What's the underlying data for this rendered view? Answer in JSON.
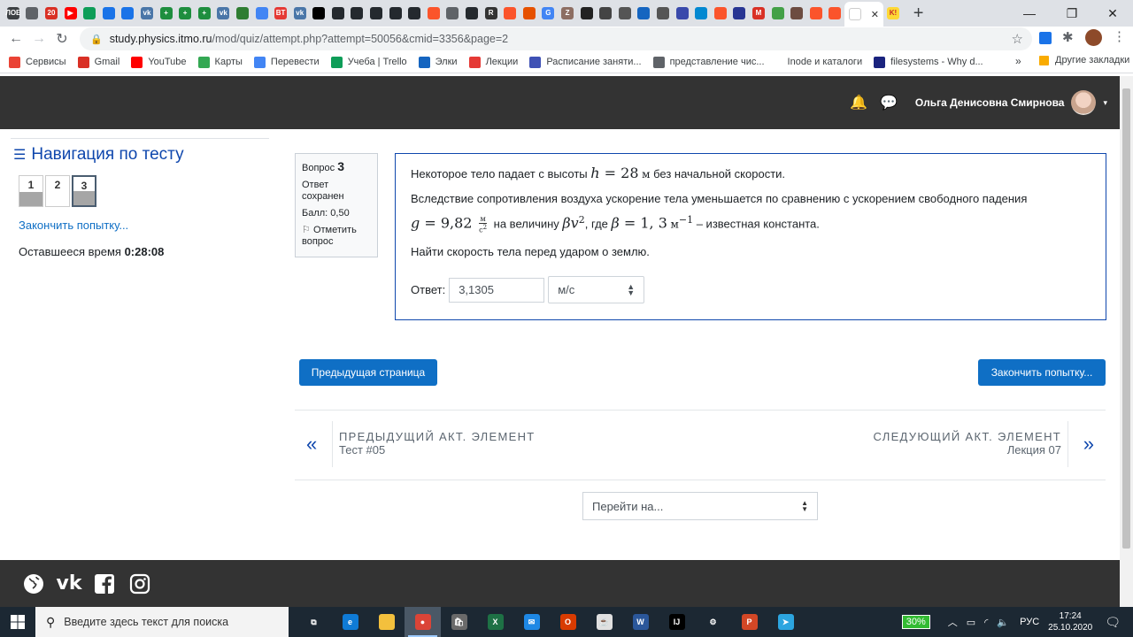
{
  "browser": {
    "tab_favicons": [
      {
        "icon": "uos-icon",
        "color": "#3c4043",
        "label": "ЛОЕ"
      },
      {
        "icon": "globe-icon",
        "color": "#5f6368",
        "label": ""
      },
      {
        "icon": "calendar-icon",
        "color": "#d93025",
        "label": "20"
      },
      {
        "icon": "youtube-icon",
        "color": "#ff0000",
        "label": "▶"
      },
      {
        "icon": "trello-icon",
        "color": "#0e9d58",
        "label": ""
      },
      {
        "icon": "chat-icon",
        "color": "#1a73e8",
        "label": ""
      },
      {
        "icon": "chat-icon",
        "color": "#1a73e8",
        "label": ""
      },
      {
        "icon": "vk-icon",
        "color": "#4a76a8",
        "label": "vk"
      },
      {
        "icon": "plus-icon",
        "color": "#1e8e3e",
        "label": "+"
      },
      {
        "icon": "plus-icon",
        "color": "#1e8e3e",
        "label": "+"
      },
      {
        "icon": "plus-icon",
        "color": "#1e8e3e",
        "label": "+"
      },
      {
        "icon": "vk-icon",
        "color": "#4a76a8",
        "label": "vk"
      },
      {
        "icon": "book-icon",
        "color": "#2e7d32",
        "label": ""
      },
      {
        "icon": "docs-icon",
        "color": "#4285f4",
        "label": ""
      },
      {
        "icon": "bt-icon",
        "color": "#e53935",
        "label": "BT"
      },
      {
        "icon": "vk-icon",
        "color": "#4a76a8",
        "label": "vk"
      },
      {
        "icon": "film-icon",
        "color": "#000000",
        "label": ""
      },
      {
        "icon": "github-icon",
        "color": "#24292e",
        "label": ""
      },
      {
        "icon": "github-icon",
        "color": "#24292e",
        "label": ""
      },
      {
        "icon": "github-icon",
        "color": "#24292e",
        "label": ""
      },
      {
        "icon": "github-icon",
        "color": "#24292e",
        "label": ""
      },
      {
        "icon": "github-icon",
        "color": "#24292e",
        "label": ""
      },
      {
        "icon": "brave-icon",
        "color": "#fb542b",
        "label": ""
      },
      {
        "icon": "globe-icon",
        "color": "#5f6368",
        "label": ""
      },
      {
        "icon": "github-icon",
        "color": "#24292e",
        "label": ""
      },
      {
        "icon": "r-icon",
        "color": "#333333",
        "label": "R"
      },
      {
        "icon": "brave-icon",
        "color": "#fb542b",
        "label": ""
      },
      {
        "icon": "paw-icon",
        "color": "#e65100",
        "label": ""
      },
      {
        "icon": "google-icon",
        "color": "#4285f4",
        "label": "G"
      },
      {
        "icon": "z-icon",
        "color": "#8d6e63",
        "label": "Z"
      },
      {
        "icon": "hh-icon",
        "color": "#222222",
        "label": ""
      },
      {
        "icon": "openai-icon",
        "color": "#444444",
        "label": ""
      },
      {
        "icon": "mail-icon",
        "color": "#555555",
        "label": ""
      },
      {
        "icon": "docs-icon",
        "color": "#1565c0",
        "label": ""
      },
      {
        "icon": "mail-icon",
        "color": "#555555",
        "label": ""
      },
      {
        "icon": "stack-icon",
        "color": "#3949ab",
        "label": ""
      },
      {
        "icon": "gear-icon",
        "color": "#0288d1",
        "label": ""
      },
      {
        "icon": "brave-icon",
        "color": "#fb542b",
        "label": ""
      },
      {
        "icon": "flag-icon",
        "color": "#283593",
        "label": ""
      },
      {
        "icon": "gmail-icon",
        "color": "#d93025",
        "label": "M"
      },
      {
        "icon": "leaf-icon",
        "color": "#43a047",
        "label": ""
      },
      {
        "icon": "puzzle-icon",
        "color": "#6d4c41",
        "label": ""
      },
      {
        "icon": "brave-icon",
        "color": "#fb542b",
        "label": ""
      },
      {
        "icon": "brave-icon",
        "color": "#fb542b",
        "label": ""
      }
    ],
    "active_tab_close": "✕",
    "last_tab_icon": "K!",
    "new_tab": "+",
    "window_controls": {
      "minimize": "—",
      "restore": "❐",
      "close": "✕"
    },
    "address": {
      "host": "study.physics.itmo.ru",
      "path": "/mod/quiz/attempt.php?attempt=50056&cmid=3356&page=2"
    },
    "bookmarks": [
      {
        "label": "Сервисы",
        "icon": "apps-icon",
        "color": "#ea4335"
      },
      {
        "label": "Gmail",
        "icon": "gmail-icon",
        "color": "#d93025"
      },
      {
        "label": "YouTube",
        "icon": "youtube-icon",
        "color": "#ff0000"
      },
      {
        "label": "Карты",
        "icon": "maps-icon",
        "color": "#34a853"
      },
      {
        "label": "Перевести",
        "icon": "translate-icon",
        "color": "#4285f4"
      },
      {
        "label": "Учеба | Trello",
        "icon": "trello-icon",
        "color": "#0e9d58"
      },
      {
        "label": "Элки",
        "icon": "elki-icon",
        "color": "#1565c0"
      },
      {
        "label": "Лекции",
        "icon": "bt-icon",
        "color": "#e53935"
      },
      {
        "label": "Расписание заняти...",
        "icon": "itmo-icon",
        "color": "#3f51b5"
      },
      {
        "label": "представление чис...",
        "icon": "globe-icon",
        "color": "#5f6368"
      },
      {
        "label": "Inode и каталоги",
        "icon": "",
        "color": "#ffffff"
      },
      {
        "label": "filesystems - Why d...",
        "icon": "ul-icon",
        "color": "#1a237e"
      }
    ],
    "bookmarks_more": "»",
    "other_bookmarks": "Другие закладки"
  },
  "header": {
    "user_name": "Ольга Денисовна Смирнова",
    "caret": "▾"
  },
  "quiz_nav": {
    "title": "Навигация по тесту",
    "questions": [
      {
        "label": "1",
        "answered": true,
        "current": false
      },
      {
        "label": "2",
        "answered": false,
        "current": false
      },
      {
        "label": "3",
        "answered": true,
        "current": true
      }
    ],
    "finish_link": "Закончить попытку...",
    "timer_label": "Оставшееся время",
    "timer_value": "0:28:08"
  },
  "question_info": {
    "label": "Вопрос",
    "number": "3",
    "state": "Ответ сохранен",
    "grade": "Балл: 0,50",
    "flag": "Отметить вопрос"
  },
  "question": {
    "p1_before": "Некоторое тело падает с высоты",
    "h_var": "h",
    "h_val": " = 28",
    "h_unit": "м",
    "p1_after": "без начальной скорости.",
    "p2_text": "Вследствие сопротивления воздуха ускорение тела уменьшается по сравнению с ускорением свободного падения",
    "g_var": "g",
    "g_val": " = 9,82",
    "g_unit_num": "м",
    "g_unit_den": "с",
    "g_unit_den_exp": "2",
    "mid_text": "на величину",
    "beta_expr": "βv",
    "beta_exp": "2",
    "where_text": ", где",
    "beta_var": "β",
    "beta_val": " = 1, 3",
    "beta_unit": "м",
    "beta_unit_exp": "−1",
    "p2_end": "– известная константа.",
    "p3": "Найти скорость тела перед ударом о землю.",
    "answer_label": "Ответ:",
    "answer_value": "3,1305",
    "unit_selected": "м/с"
  },
  "buttons": {
    "prev_page": "Предыдущая страница",
    "finish_attempt": "Закончить попытку..."
  },
  "activity_nav": {
    "prev_caption": "Предыдущий акт. элемент",
    "prev_name": "Тест #05",
    "next_caption": "Следующий акт. элемент",
    "next_name": "Лекция 07"
  },
  "jump_to": "Перейти на...",
  "footer_icons": [
    "globe-icon",
    "vk-icon",
    "facebook-icon",
    "instagram-icon"
  ],
  "taskbar": {
    "search_placeholder": "Введите здесь текст для поиска",
    "apps": [
      {
        "icon": "task-view-icon",
        "color": "#1c2833",
        "label": "⧉"
      },
      {
        "icon": "edge-icon",
        "color": "#0f7bd6",
        "label": "e"
      },
      {
        "icon": "explorer-icon",
        "color": "#f3c03d",
        "label": ""
      },
      {
        "icon": "chrome-icon",
        "color": "#db4437",
        "label": "●",
        "active": true
      },
      {
        "icon": "store-icon",
        "color": "#6a6a6a",
        "label": "🛍"
      },
      {
        "icon": "excel-icon",
        "color": "#1e7145",
        "label": "X"
      },
      {
        "icon": "mail-icon",
        "color": "#1e88e5",
        "label": "✉"
      },
      {
        "icon": "office-icon",
        "color": "#d83b01",
        "label": "O"
      },
      {
        "icon": "java-icon",
        "color": "#e0e0e0",
        "label": "☕"
      },
      {
        "icon": "word-icon",
        "color": "#2b579a",
        "label": "W"
      },
      {
        "icon": "intellij-icon",
        "color": "#000000",
        "label": "IJ"
      },
      {
        "icon": "settings-icon",
        "color": "#1c2833",
        "label": "⚙"
      },
      {
        "icon": "powerpoint-icon",
        "color": "#d24726",
        "label": "P"
      },
      {
        "icon": "telegram-icon",
        "color": "#2ca5e0",
        "label": "➤"
      }
    ],
    "battery": "30%",
    "language": "РУС",
    "time": "17:24",
    "date": "25.10.2020"
  }
}
